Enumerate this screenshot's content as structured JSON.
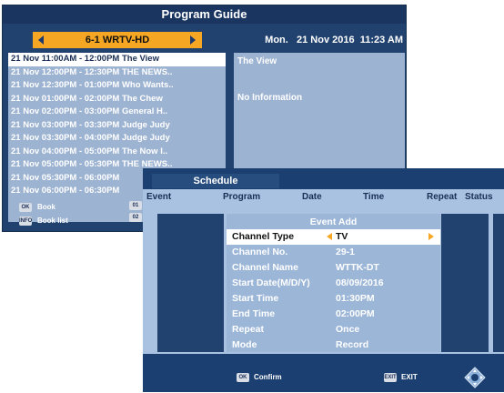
{
  "guide": {
    "title": "Program Guide",
    "channel": "6-1 WRTV-HD",
    "datetime": "Mon.   21 Nov 2016  11:23 AM",
    "programs": [
      "21 Nov 11:00AM - 12:00PM The View",
      "21 Nov 12:00PM - 12:30PM THE NEWS..",
      "21 Nov 12:30PM - 01:00PM Who Wants..",
      "21 Nov 01:00PM - 02:00PM The Chew",
      "21 Nov 02:00PM - 03:00PM General H..",
      "21 Nov 03:00PM - 03:30PM Judge Judy",
      "21 Nov 03:30PM - 04:00PM Judge Judy",
      "21 Nov 04:00PM - 05:00PM The Now I..",
      "21 Nov 05:00PM - 05:30PM THE NEWS..",
      "21 Nov 05:30PM - 06:00PM",
      "21 Nov 06:00PM - 06:30PM"
    ],
    "info_title": "The View",
    "info_desc": "No Information",
    "footer": {
      "ok_key": "OK",
      "book_label": "Book",
      "info_key": "INFO",
      "booklist_label": "Book list",
      "key_01": "01",
      "key_02": "02"
    }
  },
  "schedule": {
    "tab": "Schedule",
    "headers": {
      "event": "Event",
      "program": "Program",
      "date": "Date",
      "time": "Time",
      "repeat": "Repeat",
      "status": "Status"
    },
    "event_add": {
      "title": "Event Add",
      "fields": [
        {
          "label": "Channel Type",
          "value": "TV"
        },
        {
          "label": "Channel No.",
          "value": "29-1"
        },
        {
          "label": "Channel Name",
          "value": "WTTK-DT"
        },
        {
          "label": "Start Date(M/D/Y)",
          "value": "08/09/2016"
        },
        {
          "label": "Start Time",
          "value": "01:30PM"
        },
        {
          "label": "End Time",
          "value": "02:00PM"
        },
        {
          "label": "Repeat",
          "value": "Once"
        },
        {
          "label": "Mode",
          "value": "Record"
        }
      ]
    },
    "footer": {
      "ok_key": "OK",
      "confirm_label": "Confirm",
      "exit_key": "EXIT",
      "exit_label": "EXIT"
    }
  }
}
